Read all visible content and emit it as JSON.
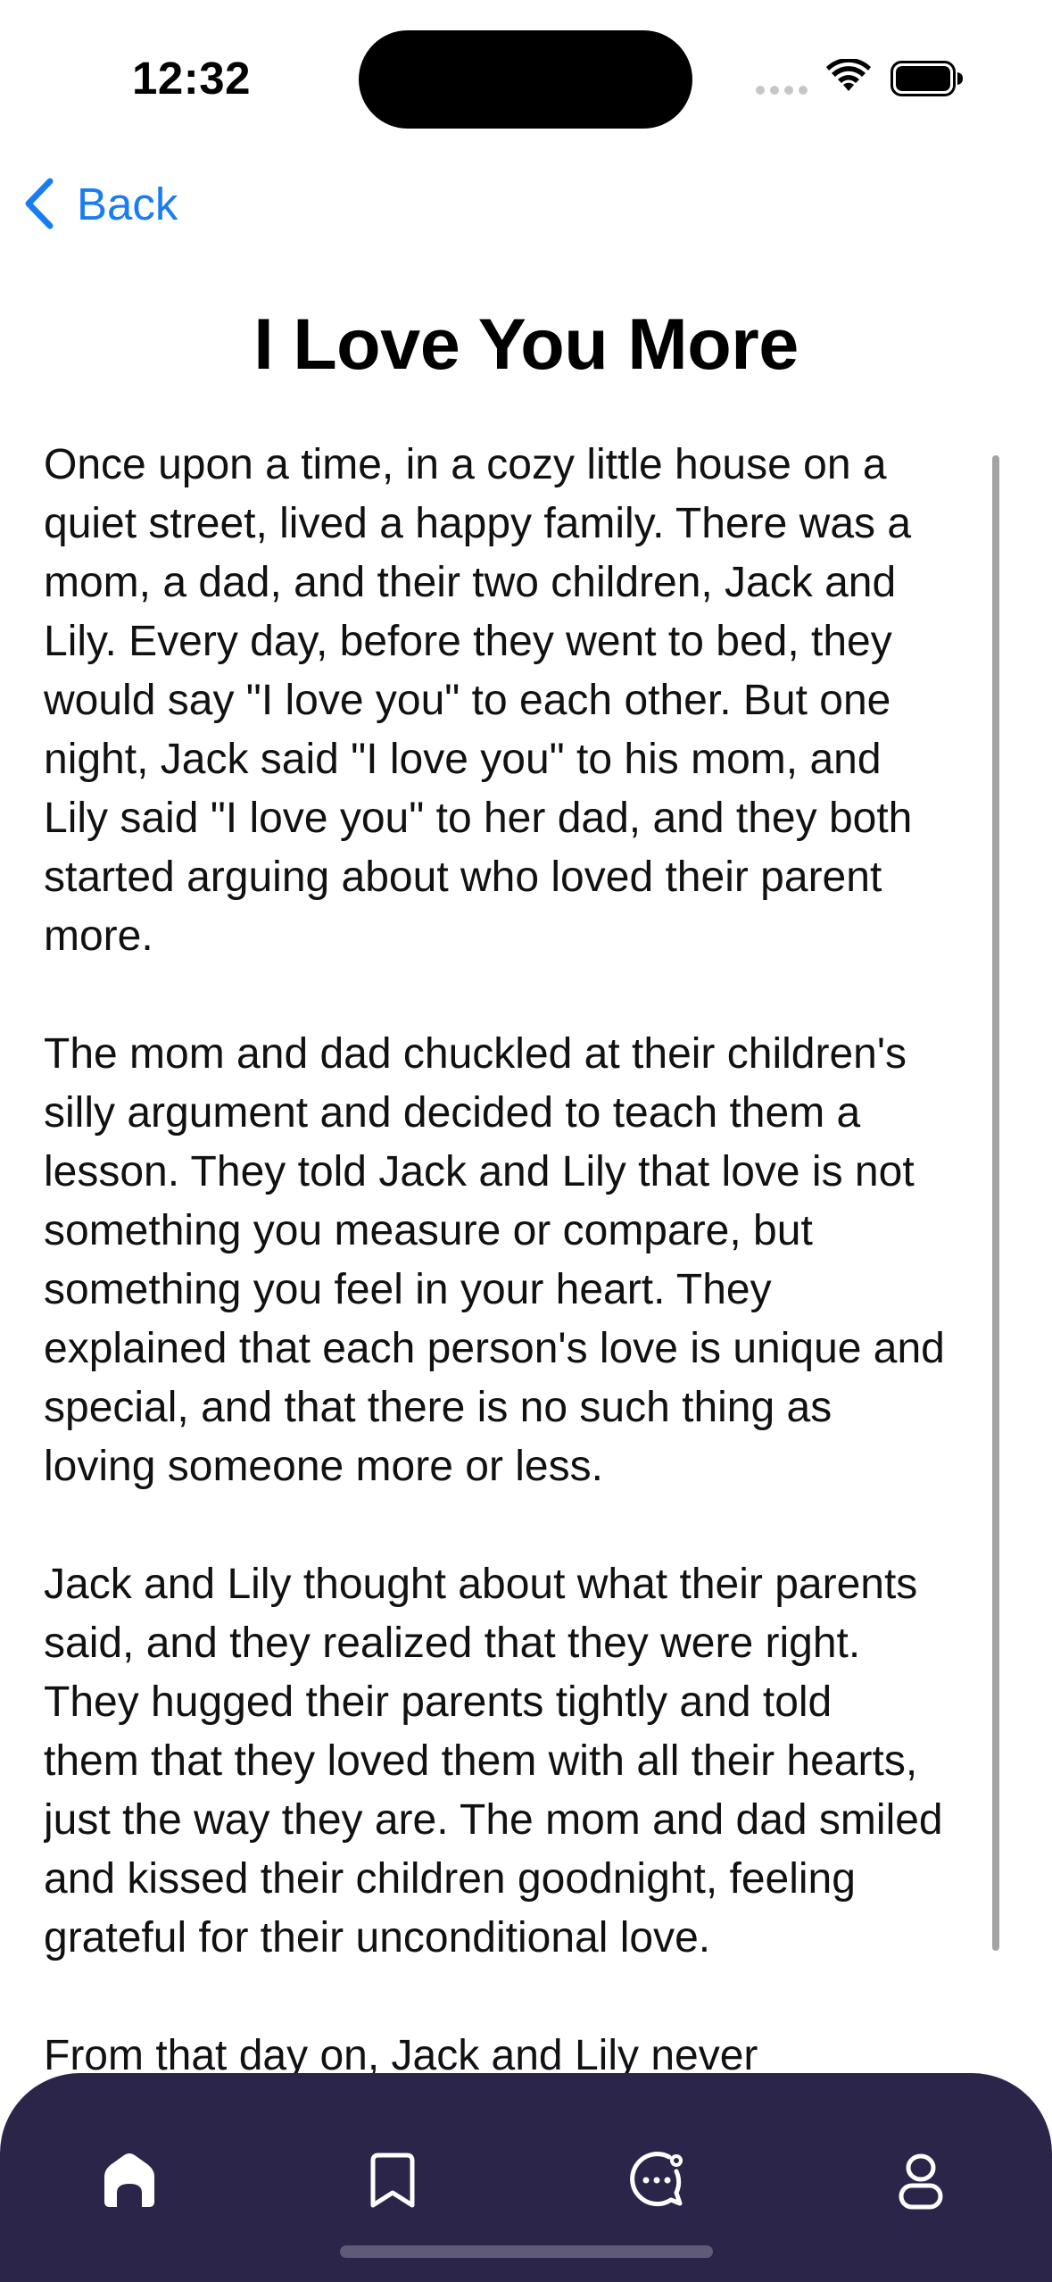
{
  "status_bar": {
    "time": "12:32",
    "icons": [
      "signal-dots-icon",
      "wifi-icon",
      "battery-icon"
    ]
  },
  "nav": {
    "back_label": "Back",
    "back_icon": "chevron-left-icon",
    "accent_color": "#1a7cf3"
  },
  "story": {
    "title": "I Love You More",
    "paragraphs": [
      "Once upon a time, in a cozy little house on a\nquiet street, lived a happy family. There was a\nmom, a dad, and their two children, Jack and\nLily. Every day, before they went to bed, they\nwould say \"I love you\" to each other. But one\nnight, Jack said \"I love you\" to his mom, and\nLily said \"I love you\" to her dad, and they both\nstarted arguing about who loved their parent\nmore.",
      "The mom and dad chuckled at their children's\nsilly argument and decided to teach them a\nlesson. They told Jack and Lily that love is not\nsomething you measure or compare, but\nsomething you feel in your heart. They\nexplained that each person's love is unique and\nspecial, and that there is no such thing as\nloving someone more or less.",
      "Jack and Lily thought about what their parents\nsaid, and they realized that they were right.\nThey hugged their parents tightly and told\nthem that they loved them with all their hearts,\njust the way they are. The mom and dad smiled\nand kissed their children goodnight, feeling\ngrateful for their unconditional love.",
      "From that day on, Jack and Lily never"
    ]
  },
  "tab_bar": {
    "background_color": "#2b254a",
    "tabs": [
      {
        "icon": "home-icon",
        "active": true
      },
      {
        "icon": "bookmark-icon",
        "active": false
      },
      {
        "icon": "chat-bubble-icon",
        "active": false
      },
      {
        "icon": "profile-icon",
        "active": false
      }
    ]
  }
}
